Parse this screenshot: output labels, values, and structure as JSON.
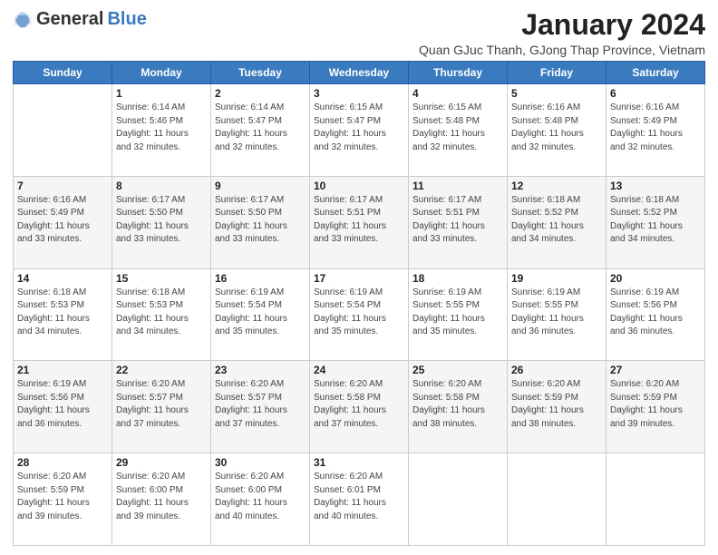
{
  "logo": {
    "general": "General",
    "blue": "Blue"
  },
  "title": "January 2024",
  "subtitle": "Quan GJuc Thanh, GJong Thap Province, Vietnam",
  "days_of_week": [
    "Sunday",
    "Monday",
    "Tuesday",
    "Wednesday",
    "Thursday",
    "Friday",
    "Saturday"
  ],
  "weeks": [
    [
      {
        "day": "",
        "sunrise": "",
        "sunset": "",
        "daylight": ""
      },
      {
        "day": "1",
        "sunrise": "Sunrise: 6:14 AM",
        "sunset": "Sunset: 5:46 PM",
        "daylight": "Daylight: 11 hours and 32 minutes."
      },
      {
        "day": "2",
        "sunrise": "Sunrise: 6:14 AM",
        "sunset": "Sunset: 5:47 PM",
        "daylight": "Daylight: 11 hours and 32 minutes."
      },
      {
        "day": "3",
        "sunrise": "Sunrise: 6:15 AM",
        "sunset": "Sunset: 5:47 PM",
        "daylight": "Daylight: 11 hours and 32 minutes."
      },
      {
        "day": "4",
        "sunrise": "Sunrise: 6:15 AM",
        "sunset": "Sunset: 5:48 PM",
        "daylight": "Daylight: 11 hours and 32 minutes."
      },
      {
        "day": "5",
        "sunrise": "Sunrise: 6:16 AM",
        "sunset": "Sunset: 5:48 PM",
        "daylight": "Daylight: 11 hours and 32 minutes."
      },
      {
        "day": "6",
        "sunrise": "Sunrise: 6:16 AM",
        "sunset": "Sunset: 5:49 PM",
        "daylight": "Daylight: 11 hours and 32 minutes."
      }
    ],
    [
      {
        "day": "7",
        "sunrise": "Sunrise: 6:16 AM",
        "sunset": "Sunset: 5:49 PM",
        "daylight": "Daylight: 11 hours and 33 minutes."
      },
      {
        "day": "8",
        "sunrise": "Sunrise: 6:17 AM",
        "sunset": "Sunset: 5:50 PM",
        "daylight": "Daylight: 11 hours and 33 minutes."
      },
      {
        "day": "9",
        "sunrise": "Sunrise: 6:17 AM",
        "sunset": "Sunset: 5:50 PM",
        "daylight": "Daylight: 11 hours and 33 minutes."
      },
      {
        "day": "10",
        "sunrise": "Sunrise: 6:17 AM",
        "sunset": "Sunset: 5:51 PM",
        "daylight": "Daylight: 11 hours and 33 minutes."
      },
      {
        "day": "11",
        "sunrise": "Sunrise: 6:17 AM",
        "sunset": "Sunset: 5:51 PM",
        "daylight": "Daylight: 11 hours and 33 minutes."
      },
      {
        "day": "12",
        "sunrise": "Sunrise: 6:18 AM",
        "sunset": "Sunset: 5:52 PM",
        "daylight": "Daylight: 11 hours and 34 minutes."
      },
      {
        "day": "13",
        "sunrise": "Sunrise: 6:18 AM",
        "sunset": "Sunset: 5:52 PM",
        "daylight": "Daylight: 11 hours and 34 minutes."
      }
    ],
    [
      {
        "day": "14",
        "sunrise": "Sunrise: 6:18 AM",
        "sunset": "Sunset: 5:53 PM",
        "daylight": "Daylight: 11 hours and 34 minutes."
      },
      {
        "day": "15",
        "sunrise": "Sunrise: 6:18 AM",
        "sunset": "Sunset: 5:53 PM",
        "daylight": "Daylight: 11 hours and 34 minutes."
      },
      {
        "day": "16",
        "sunrise": "Sunrise: 6:19 AM",
        "sunset": "Sunset: 5:54 PM",
        "daylight": "Daylight: 11 hours and 35 minutes."
      },
      {
        "day": "17",
        "sunrise": "Sunrise: 6:19 AM",
        "sunset": "Sunset: 5:54 PM",
        "daylight": "Daylight: 11 hours and 35 minutes."
      },
      {
        "day": "18",
        "sunrise": "Sunrise: 6:19 AM",
        "sunset": "Sunset: 5:55 PM",
        "daylight": "Daylight: 11 hours and 35 minutes."
      },
      {
        "day": "19",
        "sunrise": "Sunrise: 6:19 AM",
        "sunset": "Sunset: 5:55 PM",
        "daylight": "Daylight: 11 hours and 36 minutes."
      },
      {
        "day": "20",
        "sunrise": "Sunrise: 6:19 AM",
        "sunset": "Sunset: 5:56 PM",
        "daylight": "Daylight: 11 hours and 36 minutes."
      }
    ],
    [
      {
        "day": "21",
        "sunrise": "Sunrise: 6:19 AM",
        "sunset": "Sunset: 5:56 PM",
        "daylight": "Daylight: 11 hours and 36 minutes."
      },
      {
        "day": "22",
        "sunrise": "Sunrise: 6:20 AM",
        "sunset": "Sunset: 5:57 PM",
        "daylight": "Daylight: 11 hours and 37 minutes."
      },
      {
        "day": "23",
        "sunrise": "Sunrise: 6:20 AM",
        "sunset": "Sunset: 5:57 PM",
        "daylight": "Daylight: 11 hours and 37 minutes."
      },
      {
        "day": "24",
        "sunrise": "Sunrise: 6:20 AM",
        "sunset": "Sunset: 5:58 PM",
        "daylight": "Daylight: 11 hours and 37 minutes."
      },
      {
        "day": "25",
        "sunrise": "Sunrise: 6:20 AM",
        "sunset": "Sunset: 5:58 PM",
        "daylight": "Daylight: 11 hours and 38 minutes."
      },
      {
        "day": "26",
        "sunrise": "Sunrise: 6:20 AM",
        "sunset": "Sunset: 5:59 PM",
        "daylight": "Daylight: 11 hours and 38 minutes."
      },
      {
        "day": "27",
        "sunrise": "Sunrise: 6:20 AM",
        "sunset": "Sunset: 5:59 PM",
        "daylight": "Daylight: 11 hours and 39 minutes."
      }
    ],
    [
      {
        "day": "28",
        "sunrise": "Sunrise: 6:20 AM",
        "sunset": "Sunset: 5:59 PM",
        "daylight": "Daylight: 11 hours and 39 minutes."
      },
      {
        "day": "29",
        "sunrise": "Sunrise: 6:20 AM",
        "sunset": "Sunset: 6:00 PM",
        "daylight": "Daylight: 11 hours and 39 minutes."
      },
      {
        "day": "30",
        "sunrise": "Sunrise: 6:20 AM",
        "sunset": "Sunset: 6:00 PM",
        "daylight": "Daylight: 11 hours and 40 minutes."
      },
      {
        "day": "31",
        "sunrise": "Sunrise: 6:20 AM",
        "sunset": "Sunset: 6:01 PM",
        "daylight": "Daylight: 11 hours and 40 minutes."
      },
      {
        "day": "",
        "sunrise": "",
        "sunset": "",
        "daylight": ""
      },
      {
        "day": "",
        "sunrise": "",
        "sunset": "",
        "daylight": ""
      },
      {
        "day": "",
        "sunrise": "",
        "sunset": "",
        "daylight": ""
      }
    ]
  ]
}
